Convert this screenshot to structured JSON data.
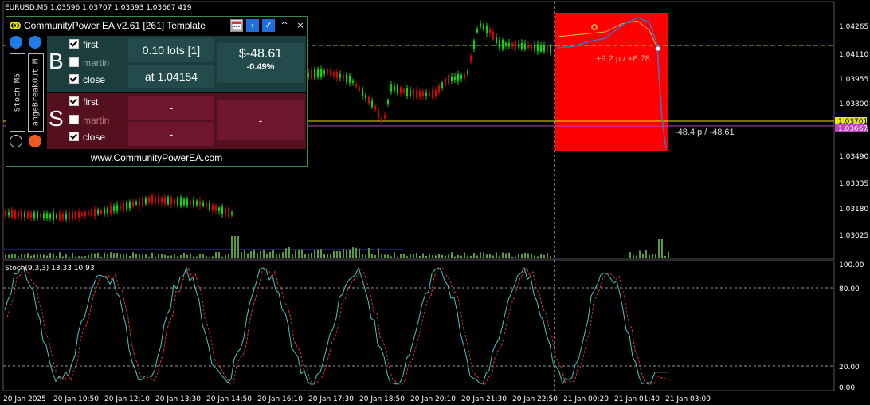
{
  "chart_header": "EURUSD,M5  1.03596 1.03707 1.03593 1.03667  419",
  "indicator_label": "Stoch(9,3,3) 13.33 10.93",
  "price_axis": [
    "1.04265",
    "1.04110",
    "1.03955",
    "1.03800",
    "1.03645",
    "1.03490",
    "1.03335",
    "1.03180",
    "1.03025"
  ],
  "price_tags": {
    "ask": "1.03701",
    "bid": "1.03667"
  },
  "stoch_axis": [
    "100.00",
    "80.00",
    "20.00",
    "0.00"
  ],
  "time_axis": [
    "20 Jan 2025",
    "20 Jan 10:50",
    "20 Jan 12:10",
    "20 Jan 13:30",
    "20 Jan 14:50",
    "20 Jan 16:10",
    "20 Jan 17:30",
    "20 Jan 18:50",
    "20 Jan 20:10",
    "20 Jan 21:30",
    "20 Jan 22:50",
    "21 Jan 00:20",
    "21 Jan 01:40",
    "21 Jan 03:00"
  ],
  "trade_labels": {
    "upper": "+9.2 p / +8.78",
    "lower": "-48.4 p / -48.61"
  },
  "colors": {
    "bull": "#00e000",
    "bear": "#e00000",
    "highlight": "#ff0000",
    "level": "#e6e600",
    "bid_line": "#c040c0",
    "stoch_main": "#3cc8c8",
    "stoch_signal": "#e03030"
  },
  "panel": {
    "title": "CommunityPower EA v2.61 [261] Template",
    "buttons": {
      "calendar": "calendar-icon",
      "next": "›",
      "ok": "✓",
      "collapse": "^",
      "close": "×"
    },
    "vtab1": "Stoch M5",
    "vtab2": "angeBreakOut M",
    "buy": {
      "letter": "B",
      "checks": [
        {
          "label": "first",
          "on": true
        },
        {
          "label": "martin",
          "on": false
        },
        {
          "label": "close",
          "on": true
        }
      ],
      "lots": "0.10 lots [1]",
      "price": "at 1.04154",
      "pnl": "$-48.61",
      "pct": "-0.49%"
    },
    "sell": {
      "letter": "S",
      "checks": [
        {
          "label": "first",
          "on": true
        },
        {
          "label": "martin",
          "on": false
        },
        {
          "label": "close",
          "on": true
        }
      ],
      "lots": "-",
      "price": "-",
      "pnl": "-"
    },
    "website": "www.CommunityPowerEA.com"
  }
}
